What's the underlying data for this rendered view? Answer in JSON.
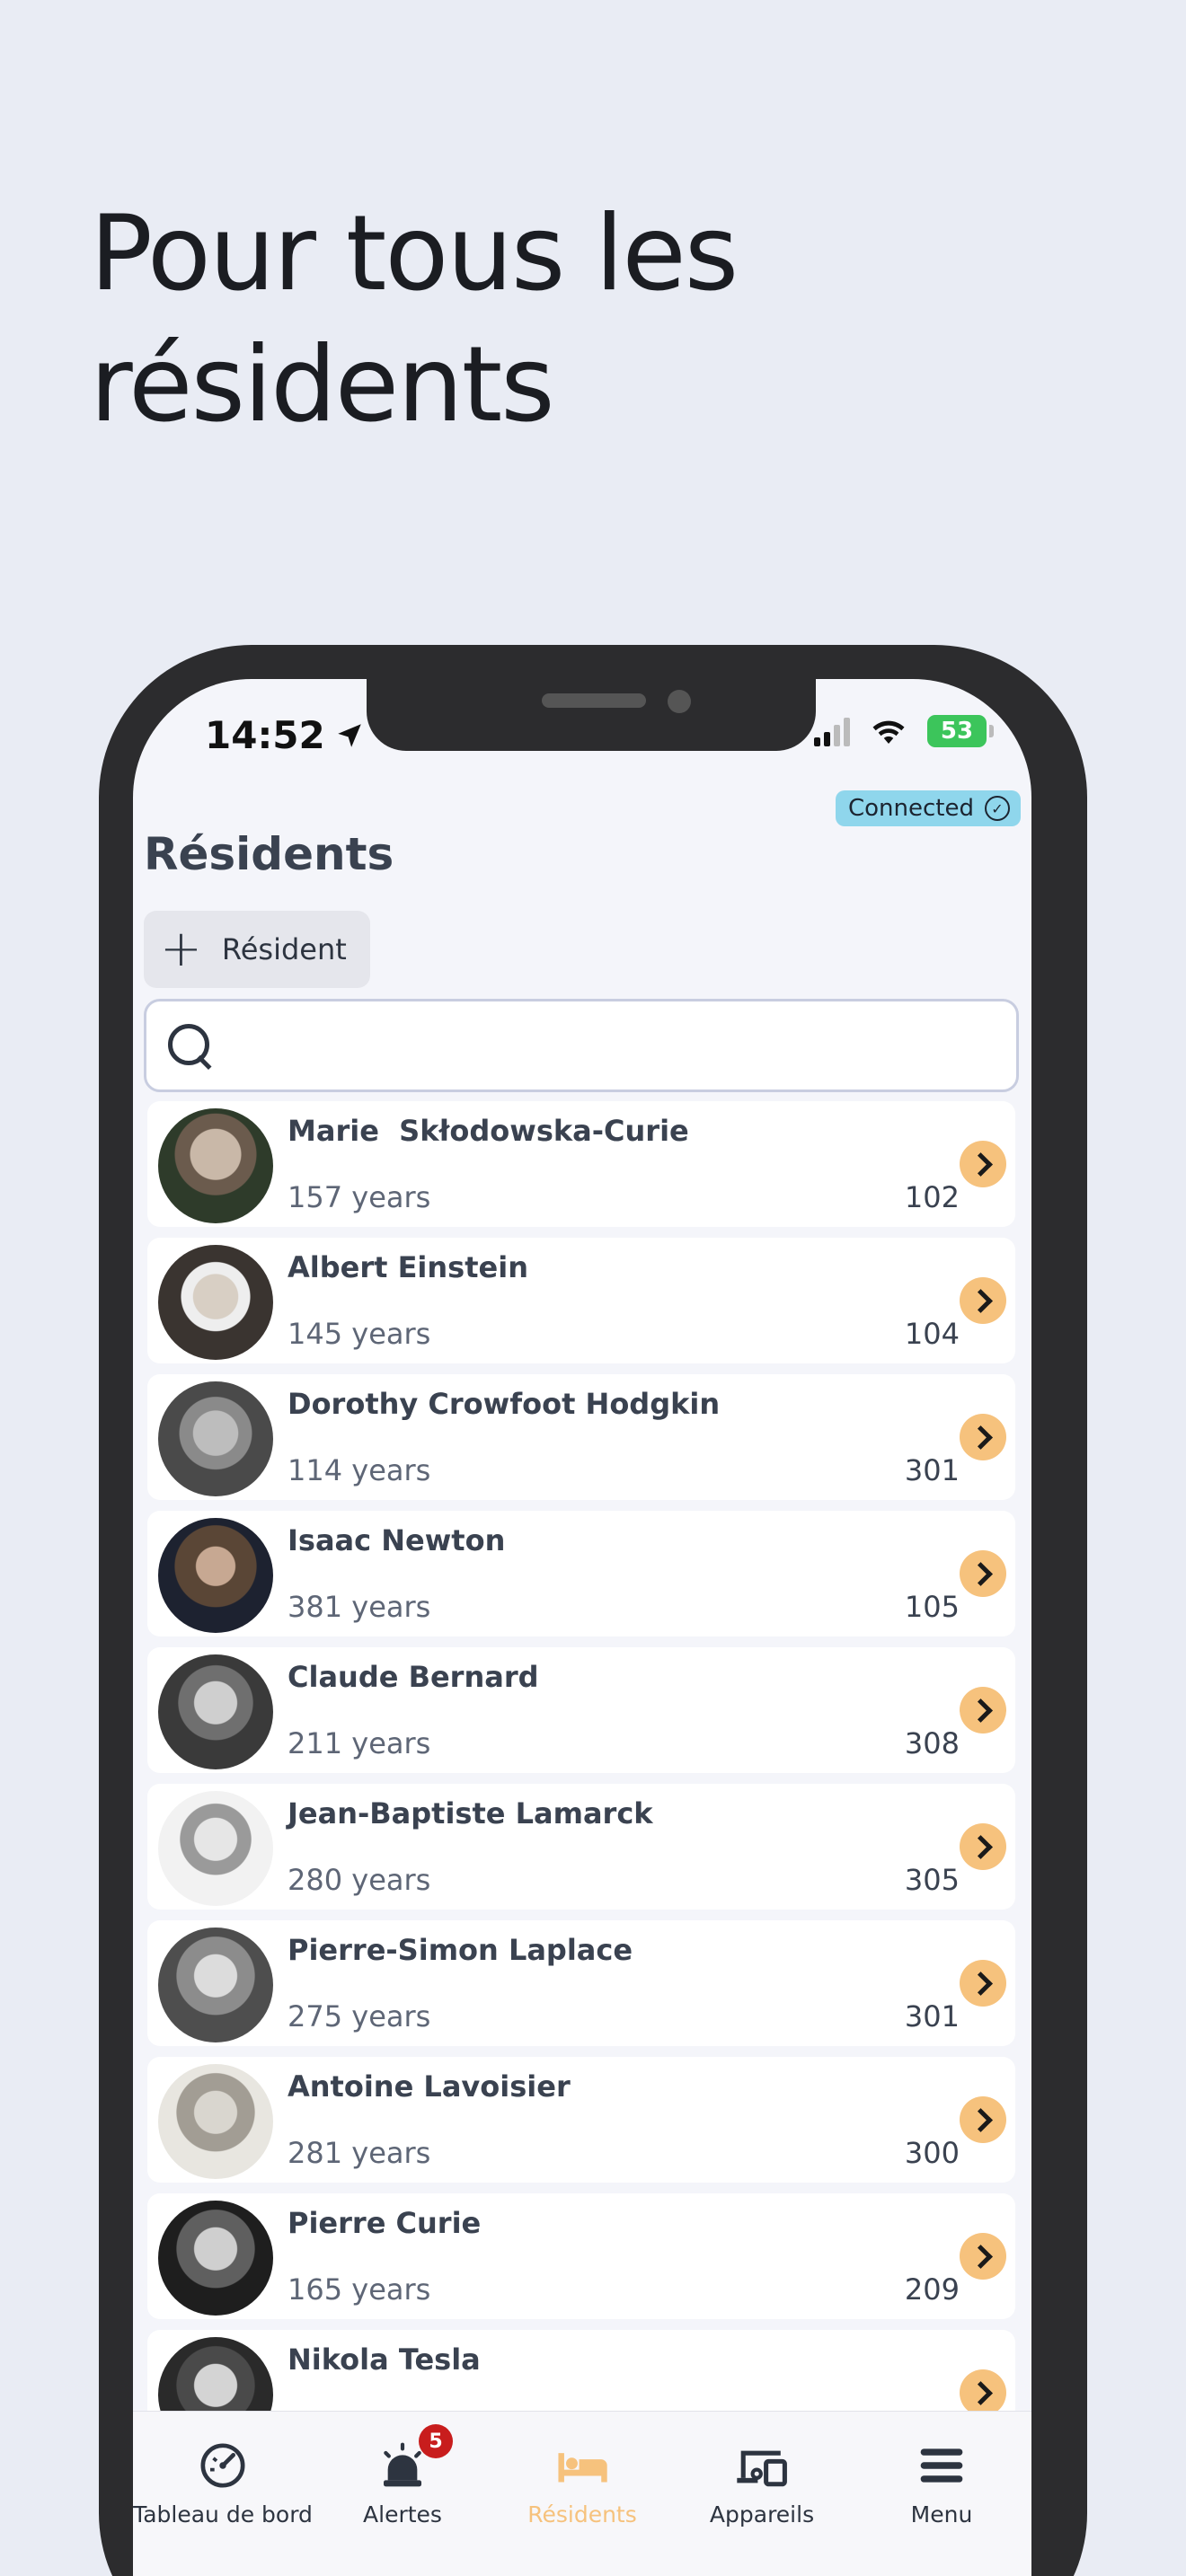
{
  "headline": "Pour tous les résidents",
  "status_bar": {
    "time": "14:52",
    "battery": "53"
  },
  "connection": {
    "label": "Connected"
  },
  "page": {
    "title": "Résidents"
  },
  "toolbar": {
    "add_label": "Résident"
  },
  "search": {
    "value": "",
    "placeholder": ""
  },
  "residents": [
    {
      "name": "Marie  Skłodowska-Curie",
      "age": "157 years",
      "room": "102"
    },
    {
      "name": "Albert Einstein",
      "age": "145 years",
      "room": "104"
    },
    {
      "name": "Dorothy Crowfoot Hodgkin",
      "age": "114 years",
      "room": "301"
    },
    {
      "name": "Isaac Newton",
      "age": "381 years",
      "room": "105"
    },
    {
      "name": "Claude Bernard",
      "age": "211 years",
      "room": "308"
    },
    {
      "name": "Jean-Baptiste Lamarck",
      "age": "280 years",
      "room": "305"
    },
    {
      "name": "Pierre-Simon Laplace",
      "age": "275 years",
      "room": "301"
    },
    {
      "name": "Antoine Lavoisier",
      "age": "281 years",
      "room": "300"
    },
    {
      "name": "Pierre Curie",
      "age": "165 years",
      "room": "209"
    },
    {
      "name": "Nikola Tesla",
      "age": "",
      "room": ""
    }
  ],
  "tabbar": {
    "tabs": [
      {
        "label": "Tableau de bord",
        "icon": "gauge-icon"
      },
      {
        "label": "Alertes",
        "icon": "alarm-icon",
        "badge": "5"
      },
      {
        "label": "Résidents",
        "icon": "bed-icon",
        "active": true
      },
      {
        "label": "Appareils",
        "icon": "devices-icon"
      },
      {
        "label": "Menu",
        "icon": "menu-icon"
      }
    ]
  },
  "colors": {
    "accent": "#f6c27d",
    "alert": "#c81d1d",
    "connected": "#8fd6ec",
    "background": "#e9ecf4"
  }
}
